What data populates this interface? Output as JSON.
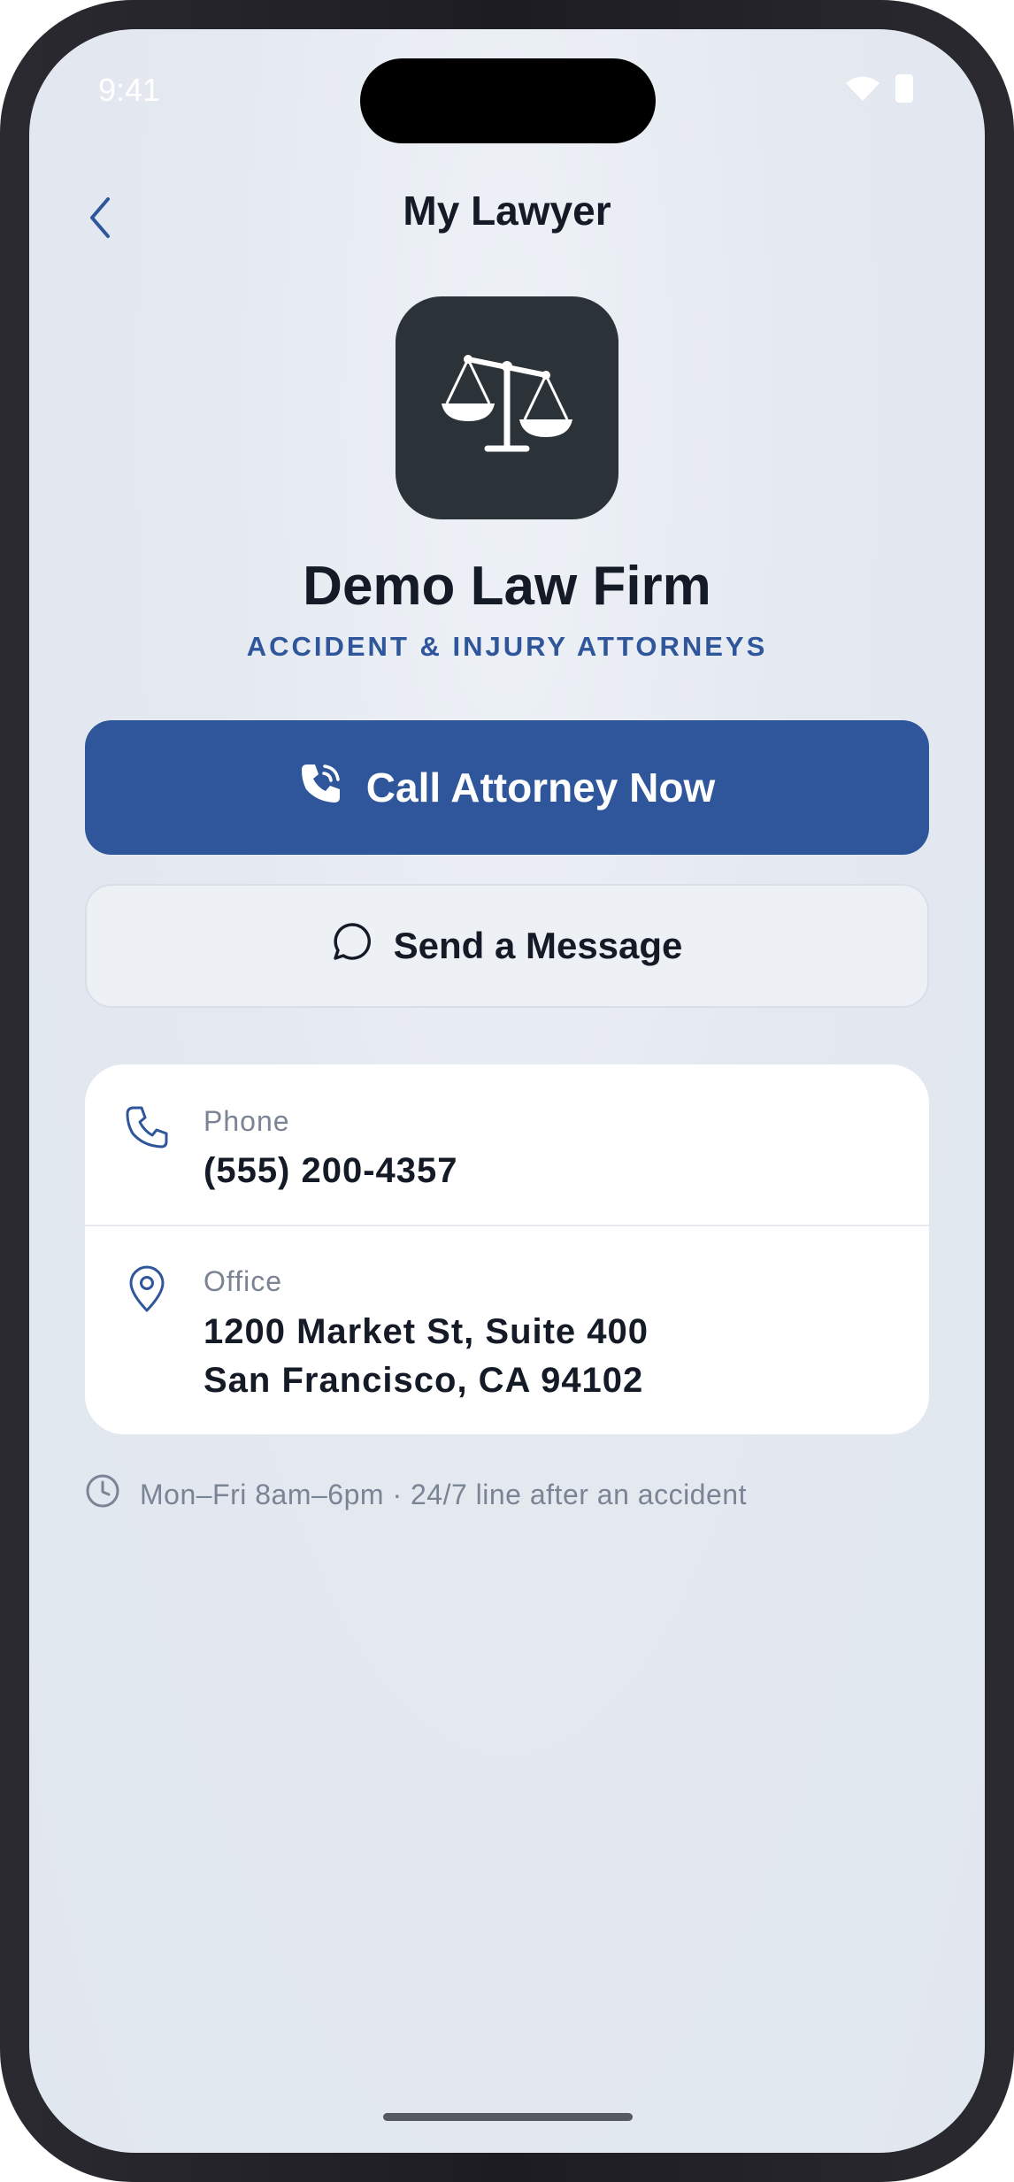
{
  "status_bar": {
    "time": "9:41",
    "icons": [
      "wifi-icon",
      "battery-icon"
    ]
  },
  "nav": {
    "title": "My Lawyer",
    "back_icon": "chevron-left-icon"
  },
  "firm": {
    "logo_icon": "scales-of-justice-icon",
    "name": "Demo Law Firm",
    "tagline": "ACCIDENT & INJURY ATTORNEYS"
  },
  "actions": {
    "call_label": "Call Attorney Now",
    "call_icon": "phone-ringing-icon",
    "message_label": "Send a Message",
    "message_icon": "chat-bubble-icon"
  },
  "contact": {
    "phone": {
      "label": "Phone",
      "value": "(555) 200-4357",
      "icon": "phone-icon"
    },
    "office": {
      "label": "Office",
      "line1": "1200 Market St, Suite 400",
      "line2": "San Francisco, CA 94102",
      "icon": "map-pin-icon"
    }
  },
  "hours": {
    "text": "Mon–Fri 8am–6pm · 24/7 line after an accident",
    "icon": "clock-icon"
  },
  "colors": {
    "primary": "#2f569b",
    "dark_tile": "#2b3238",
    "text": "#141a26",
    "muted": "#7b8494"
  }
}
